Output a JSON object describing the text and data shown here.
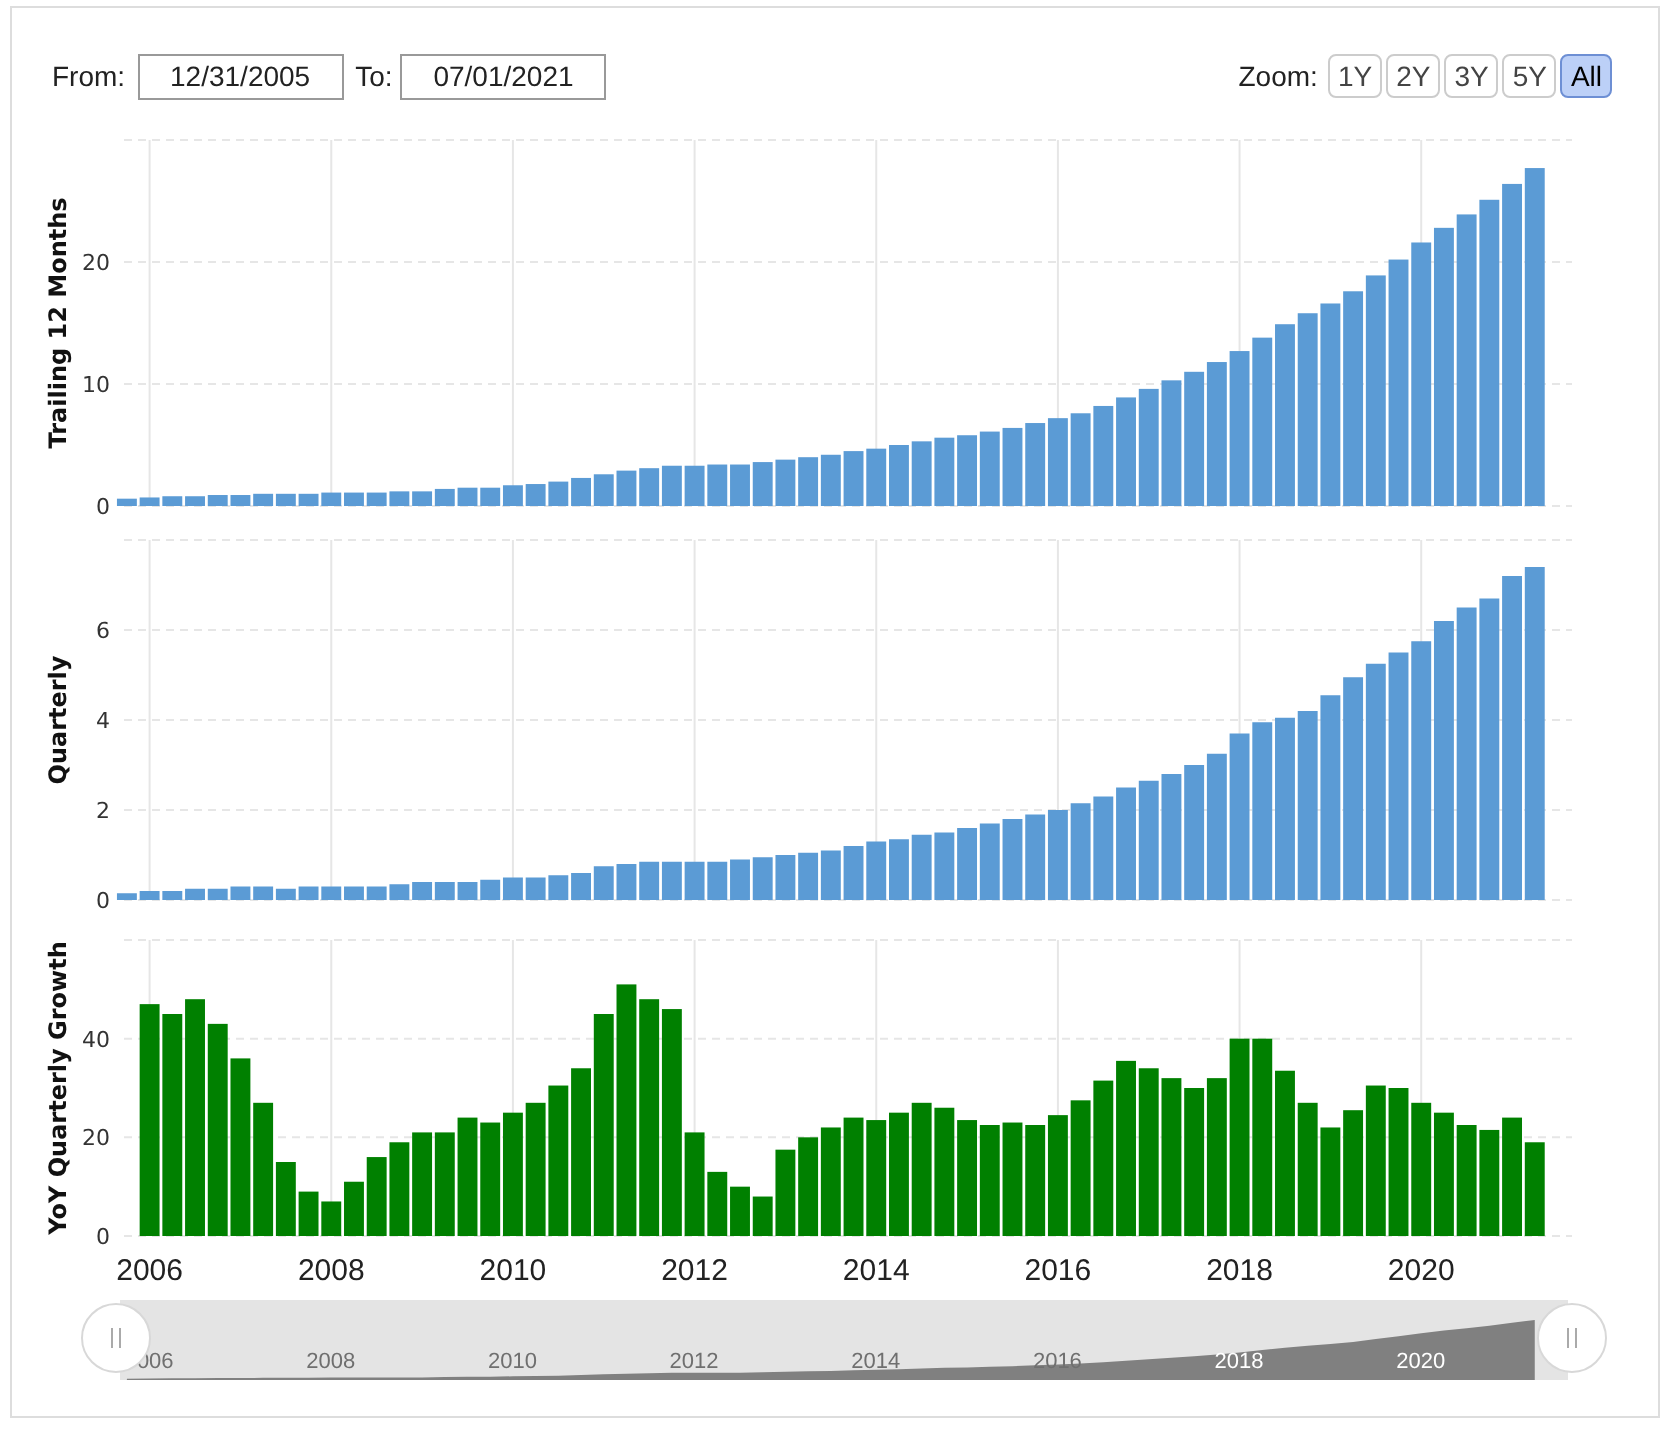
{
  "range": {
    "from_label": "From:",
    "from": "12/31/2005",
    "to_label": "To:",
    "to": "07/01/2021"
  },
  "zoom": {
    "label": "Zoom:",
    "buttons": [
      {
        "label": "1Y",
        "selected": false
      },
      {
        "label": "2Y",
        "selected": false
      },
      {
        "label": "3Y",
        "selected": false
      },
      {
        "label": "5Y",
        "selected": false
      },
      {
        "label": "All",
        "selected": true
      }
    ]
  },
  "charts": [
    {
      "chart_data": {
        "type": "bar",
        "ylabel": "Trailing 12 Months",
        "xlim": [
          2005.63,
          2021.66
        ],
        "ylim": [
          0,
          30
        ],
        "yticks": [
          0,
          10,
          20
        ],
        "grid": true,
        "x": [
          2005.75,
          2006,
          2006.25,
          2006.5,
          2006.75,
          2007,
          2007.25,
          2007.5,
          2007.75,
          2008,
          2008.25,
          2008.5,
          2008.75,
          2009,
          2009.25,
          2009.5,
          2009.75,
          2010,
          2010.25,
          2010.5,
          2010.75,
          2011,
          2011.25,
          2011.5,
          2011.75,
          2012,
          2012.25,
          2012.5,
          2012.75,
          2013,
          2013.25,
          2013.5,
          2013.75,
          2014,
          2014.25,
          2014.5,
          2014.75,
          2015,
          2015.25,
          2015.5,
          2015.75,
          2016,
          2016.25,
          2016.5,
          2016.75,
          2017,
          2017.25,
          2017.5,
          2017.75,
          2018,
          2018.25,
          2018.5,
          2018.75,
          2019,
          2019.25,
          2019.5,
          2019.75,
          2020,
          2020.25,
          2020.5,
          2020.75,
          2021,
          2021.25
        ],
        "series": [
          {
            "color": "#5b9bd5",
            "values": [
              0.6,
              0.7,
              0.8,
              0.8,
              0.9,
              0.9,
              1.0,
              1.0,
              1.0,
              1.1,
              1.1,
              1.1,
              1.2,
              1.2,
              1.4,
              1.5,
              1.5,
              1.7,
              1.8,
              2.0,
              2.3,
              2.6,
              2.9,
              3.1,
              3.3,
              3.3,
              3.4,
              3.4,
              3.6,
              3.8,
              4.0,
              4.2,
              4.5,
              4.7,
              5.0,
              5.3,
              5.6,
              5.8,
              6.1,
              6.4,
              6.8,
              7.2,
              7.6,
              8.2,
              8.9,
              9.6,
              10.3,
              11.0,
              11.8,
              12.7,
              13.8,
              14.9,
              15.8,
              16.6,
              17.6,
              18.9,
              20.2,
              21.6,
              22.8,
              23.9,
              25.1,
              26.4,
              27.7
            ]
          }
        ]
      }
    },
    {
      "chart_data": {
        "type": "bar",
        "ylabel": "Quarterly",
        "xlim": [
          2005.63,
          2021.66
        ],
        "ylim": [
          0,
          8
        ],
        "yticks": [
          0,
          2,
          4,
          6
        ],
        "grid": true,
        "x": [
          2005.75,
          2006,
          2006.25,
          2006.5,
          2006.75,
          2007,
          2007.25,
          2007.5,
          2007.75,
          2008,
          2008.25,
          2008.5,
          2008.75,
          2009,
          2009.25,
          2009.5,
          2009.75,
          2010,
          2010.25,
          2010.5,
          2010.75,
          2011,
          2011.25,
          2011.5,
          2011.75,
          2012,
          2012.25,
          2012.5,
          2012.75,
          2013,
          2013.25,
          2013.5,
          2013.75,
          2014,
          2014.25,
          2014.5,
          2014.75,
          2015,
          2015.25,
          2015.5,
          2015.75,
          2016,
          2016.25,
          2016.5,
          2016.75,
          2017,
          2017.25,
          2017.5,
          2017.75,
          2018,
          2018.25,
          2018.5,
          2018.75,
          2019,
          2019.25,
          2019.5,
          2019.75,
          2020,
          2020.25,
          2020.5,
          2020.75,
          2021,
          2021.25
        ],
        "series": [
          {
            "color": "#5b9bd5",
            "values": [
              0.15,
              0.2,
              0.2,
              0.25,
              0.25,
              0.3,
              0.3,
              0.25,
              0.3,
              0.3,
              0.3,
              0.3,
              0.35,
              0.4,
              0.4,
              0.4,
              0.45,
              0.5,
              0.5,
              0.55,
              0.6,
              0.75,
              0.8,
              0.85,
              0.85,
              0.85,
              0.85,
              0.9,
              0.95,
              1.0,
              1.05,
              1.1,
              1.2,
              1.3,
              1.35,
              1.45,
              1.5,
              1.6,
              1.7,
              1.8,
              1.9,
              2.0,
              2.15,
              2.3,
              2.5,
              2.65,
              2.8,
              3.0,
              3.25,
              3.7,
              3.95,
              4.05,
              4.2,
              4.55,
              4.95,
              5.25,
              5.5,
              5.75,
              6.2,
              6.5,
              6.7,
              7.2,
              7.4
            ]
          }
        ]
      }
    },
    {
      "chart_data": {
        "type": "bar",
        "ylabel": "YoY Quarterly Growth",
        "xlim": [
          2005.63,
          2021.66
        ],
        "ylim": [
          0,
          60
        ],
        "yticks": [
          0,
          20,
          40
        ],
        "grid": true,
        "xticks": [
          {
            "value": 2006,
            "label": "2006"
          },
          {
            "value": 2008,
            "label": "2008"
          },
          {
            "value": 2010,
            "label": "2010"
          },
          {
            "value": 2012,
            "label": "2012"
          },
          {
            "value": 2014,
            "label": "2014"
          },
          {
            "value": 2016,
            "label": "2016"
          },
          {
            "value": 2018,
            "label": "2018"
          },
          {
            "value": 2020,
            "label": "2020"
          }
        ],
        "x": [
          2006,
          2006.25,
          2006.5,
          2006.75,
          2007,
          2007.25,
          2007.5,
          2007.75,
          2008,
          2008.25,
          2008.5,
          2008.75,
          2009,
          2009.25,
          2009.5,
          2009.75,
          2010,
          2010.25,
          2010.5,
          2010.75,
          2011,
          2011.25,
          2011.5,
          2011.75,
          2012,
          2012.25,
          2012.5,
          2012.75,
          2013,
          2013.25,
          2013.5,
          2013.75,
          2014,
          2014.25,
          2014.5,
          2014.75,
          2015,
          2015.25,
          2015.5,
          2015.75,
          2016,
          2016.25,
          2016.5,
          2016.75,
          2017,
          2017.25,
          2017.5,
          2017.75,
          2018,
          2018.25,
          2018.5,
          2018.75,
          2019,
          2019.25,
          2019.5,
          2019.75,
          2020,
          2020.25,
          2020.5,
          2020.75,
          2021,
          2021.25
        ],
        "series": [
          {
            "color": "#008000",
            "values": [
              47,
              45,
              48,
              43,
              36,
              27,
              15,
              9,
              7,
              11,
              16,
              19,
              21,
              21,
              24,
              23,
              25,
              27,
              30.5,
              34,
              45,
              51,
              48,
              46,
              21,
              13,
              10,
              8,
              17.5,
              20,
              22,
              24,
              23.5,
              25,
              27,
              26,
              23.5,
              22.5,
              23,
              22.5,
              24.5,
              27.5,
              31.5,
              35.5,
              34,
              32,
              30,
              32,
              40,
              40,
              33.5,
              27,
              22,
              25.5,
              30.5,
              30,
              27,
              25,
              22.5,
              21.5,
              24,
              19
            ]
          }
        ]
      }
    }
  ],
  "navigator": {
    "labels": [
      "006",
      "2008",
      "2010",
      "2012",
      "2014",
      "2016",
      "2018",
      "2020"
    ]
  }
}
